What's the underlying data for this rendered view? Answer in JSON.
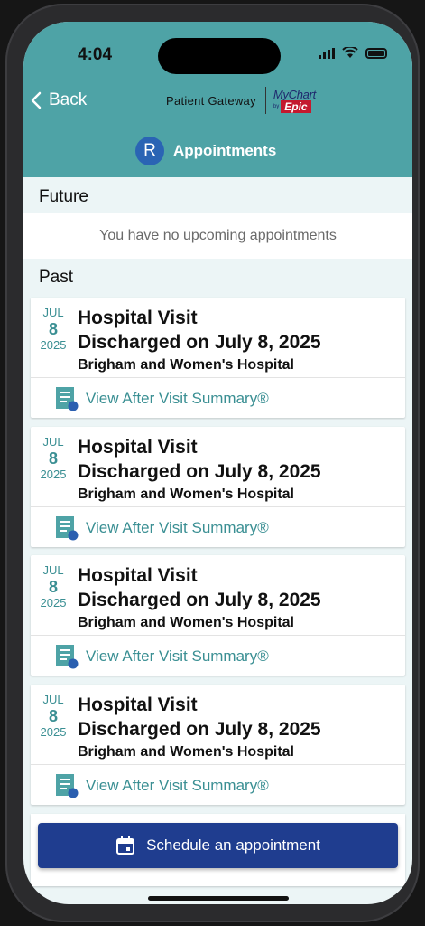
{
  "status": {
    "time": "4:04"
  },
  "header": {
    "back_label": "Back",
    "brand_text": "Patient Gateway",
    "mychart_text": "MyChart",
    "by_text": "by",
    "epic_text": "Epic",
    "avatar_initial": "R",
    "title": "Appointments"
  },
  "future": {
    "label": "Future",
    "empty_text": "You have no upcoming appointments"
  },
  "past": {
    "label": "Past",
    "items": [
      {
        "month": "JUL",
        "day": "8",
        "year": "2025",
        "title": "Hospital Visit",
        "subtitle": "Discharged on July 8, 2025",
        "location": "Brigham and Women's Hospital",
        "link": "View After Visit Summary®"
      },
      {
        "month": "JUL",
        "day": "8",
        "year": "2025",
        "title": "Hospital Visit",
        "subtitle": "Discharged on July 8, 2025",
        "location": "Brigham and Women's Hospital",
        "link": "View After Visit Summary®"
      },
      {
        "month": "JUL",
        "day": "8",
        "year": "2025",
        "title": "Hospital Visit",
        "subtitle": "Discharged on July 8, 2025",
        "location": "Brigham and Women's Hospital",
        "link": "View After Visit Summary®"
      },
      {
        "month": "JUL",
        "day": "8",
        "year": "2025",
        "title": "Hospital Visit",
        "subtitle": "Discharged on July 8, 2025",
        "location": "Brigham and Women's Hospital",
        "link": "View After Visit Summary®"
      }
    ]
  },
  "schedule_label": "Schedule an appointment",
  "colors": {
    "header": "#4ea3a6",
    "accent": "#3a8f93",
    "button": "#1f3d8f",
    "avatar": "#2a64b4"
  },
  "icons": {
    "back": "chevron-left-icon",
    "summary": "document-icon",
    "calendar": "calendar-icon"
  }
}
